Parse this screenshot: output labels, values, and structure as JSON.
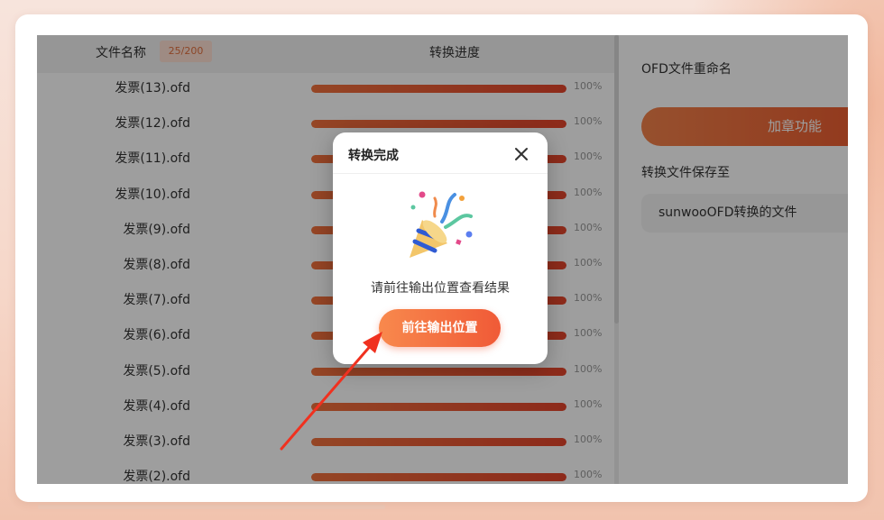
{
  "table": {
    "name_header": "文件名称",
    "count_badge": "25/200",
    "progress_header": "转换进度",
    "rows": [
      {
        "name": "发票(13).ofd",
        "progress": 1.0,
        "percent": "100%"
      },
      {
        "name": "发票(12).ofd",
        "progress": 1.0,
        "percent": "100%"
      },
      {
        "name": "发票(11).ofd",
        "progress": 1.0,
        "percent": "100%"
      },
      {
        "name": "发票(10).ofd",
        "progress": 1.0,
        "percent": "100%"
      },
      {
        "name": "发票(9).ofd",
        "progress": 1.0,
        "percent": "100%"
      },
      {
        "name": "发票(8).ofd",
        "progress": 1.0,
        "percent": "100%"
      },
      {
        "name": "发票(7).ofd",
        "progress": 1.0,
        "percent": "100%"
      },
      {
        "name": "发票(6).ofd",
        "progress": 1.0,
        "percent": "100%"
      },
      {
        "name": "发票(5).ofd",
        "progress": 1.0,
        "percent": "100%"
      },
      {
        "name": "发票(4).ofd",
        "progress": 1.0,
        "percent": "100%"
      },
      {
        "name": "发票(3).ofd",
        "progress": 1.0,
        "percent": "100%"
      },
      {
        "name": "发票(2).ofd",
        "progress": 1.0,
        "percent": "100%"
      }
    ]
  },
  "right_panel": {
    "rename_label": "OFD文件重命名",
    "stamp_button": "加章功能",
    "save_to_label": "转换文件保存至",
    "save_folder": "sunwooOFD转换的文件"
  },
  "modal": {
    "title": "转换完成",
    "message": "请前往输出位置查看结果",
    "go_button": "前往输出位置",
    "close_icon": "close-icon",
    "illustration_icon": "party-popper-icon"
  },
  "colors": {
    "accent": "#f05a37",
    "badge_bg": "#ffe1d3",
    "badge_text": "#e2703f",
    "annotation_arrow": "#f0311f"
  }
}
